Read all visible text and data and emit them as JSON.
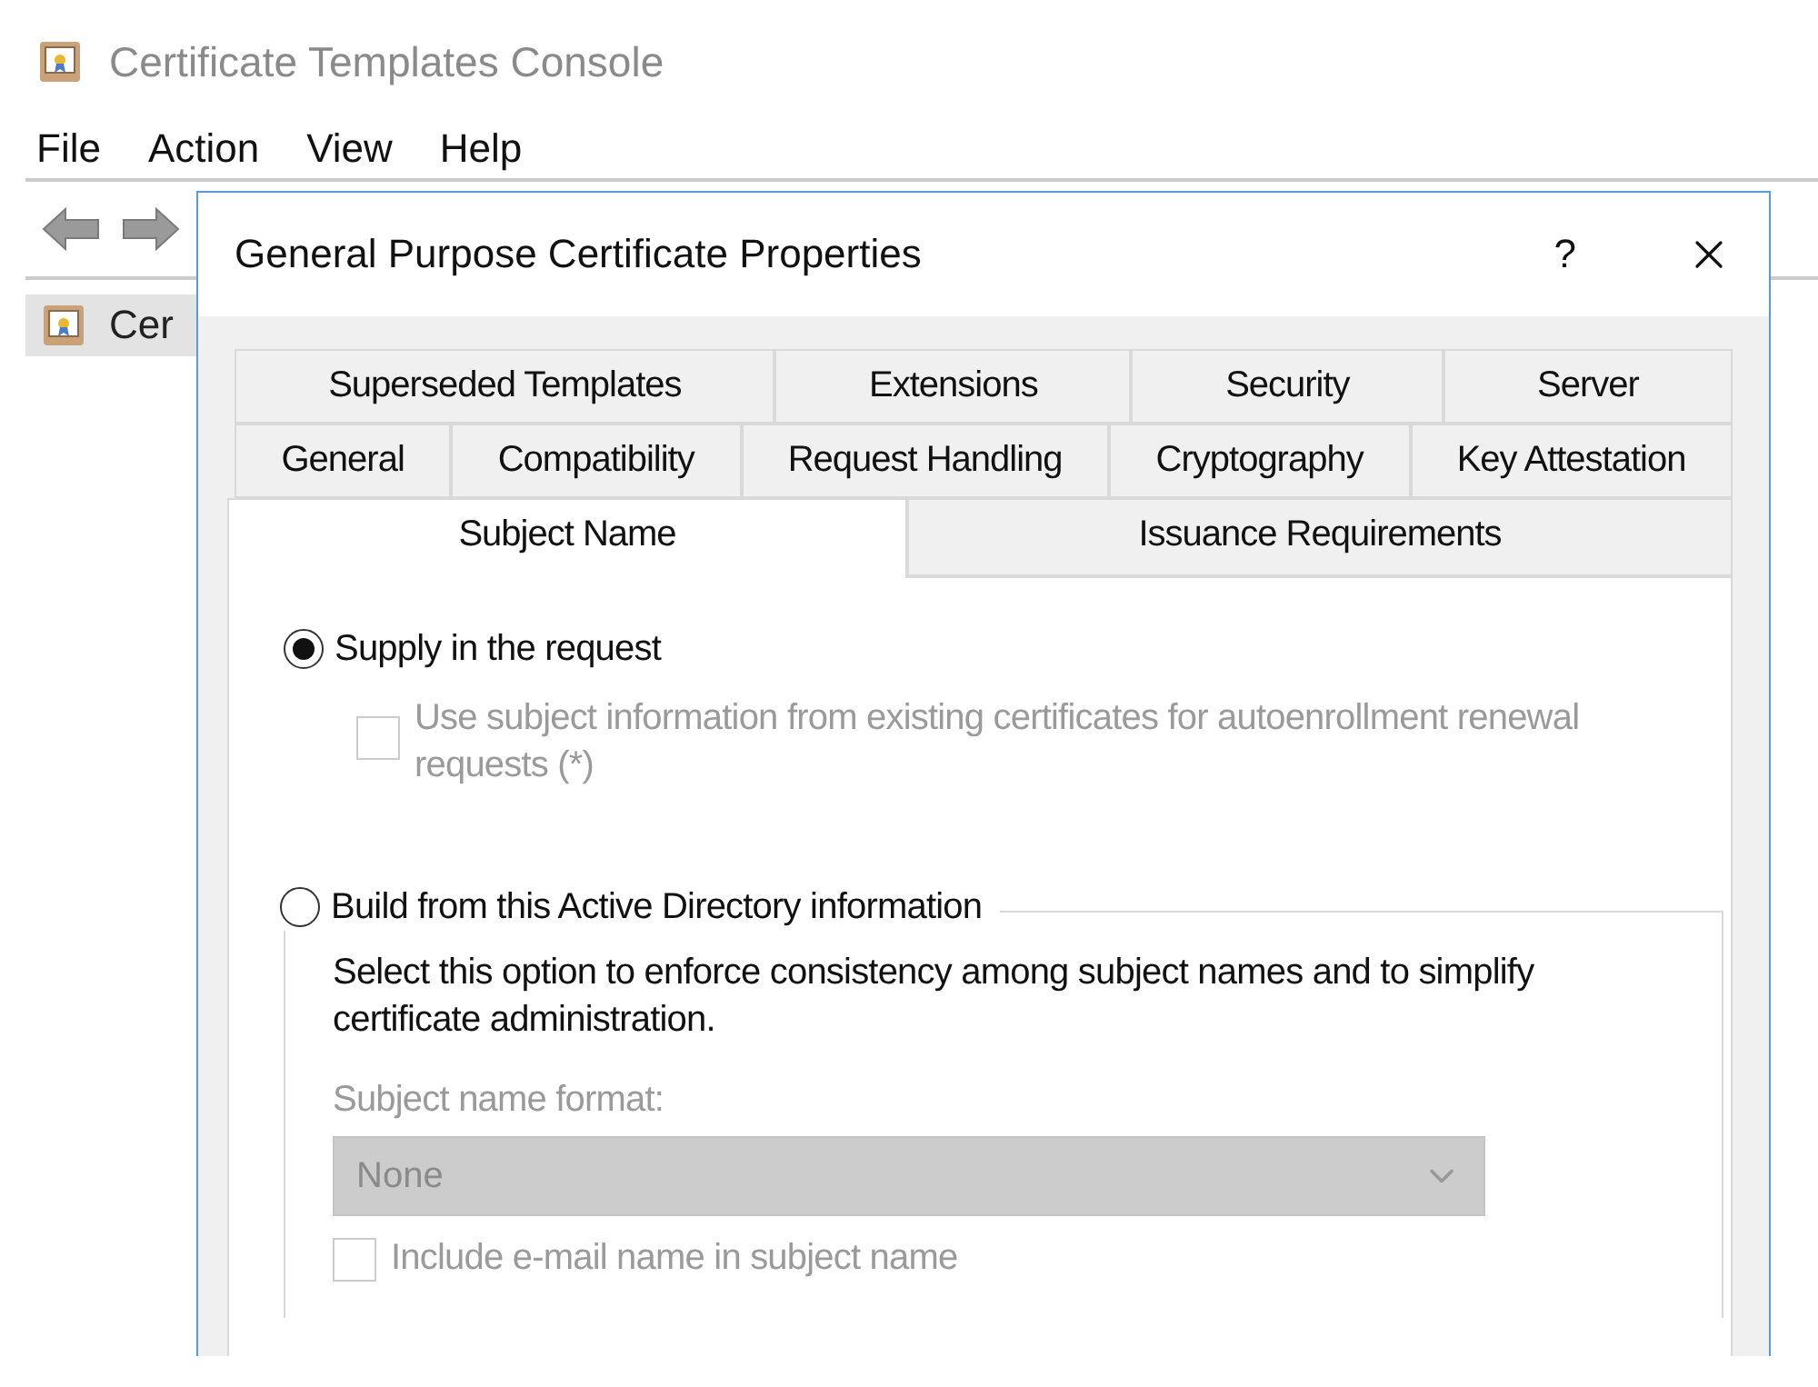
{
  "console": {
    "title": "Certificate Templates Console",
    "menu": [
      "File",
      "Action",
      "View",
      "Help"
    ],
    "tree": [
      {
        "label": "Cer",
        "selected": true
      }
    ]
  },
  "dialog": {
    "title": "General Purpose Certificate Properties",
    "help": "?",
    "tab_rows": [
      [
        {
          "label": "Superseded Templates",
          "selected": false
        },
        {
          "label": "Extensions",
          "selected": false
        },
        {
          "label": "Security",
          "selected": false
        },
        {
          "label": "Server",
          "selected": false
        }
      ],
      [
        {
          "label": "General",
          "selected": false
        },
        {
          "label": "Compatibility",
          "selected": false
        },
        {
          "label": "Request Handling",
          "selected": false
        },
        {
          "label": "Cryptography",
          "selected": false
        },
        {
          "label": "Key Attestation",
          "selected": false
        }
      ],
      [
        {
          "label": "Subject Name",
          "selected": true
        },
        {
          "label": "Issuance Requirements",
          "selected": false
        }
      ]
    ],
    "supply": {
      "label": "Supply in the request",
      "selected": true,
      "option": {
        "label": "Use subject information from existing certificates for autoenrollment renewal requests (*)",
        "checked": false,
        "disabled": true
      }
    },
    "build": {
      "label": "Build from this Active Directory information",
      "selected": false,
      "description": "Select this option to enforce consistency among subject names and to simplify certificate administration.",
      "format_label": "Subject name format:",
      "format_value": "None",
      "disabled": true,
      "email": {
        "label": "Include e-mail name in subject name",
        "checked": false,
        "disabled": true
      }
    }
  }
}
